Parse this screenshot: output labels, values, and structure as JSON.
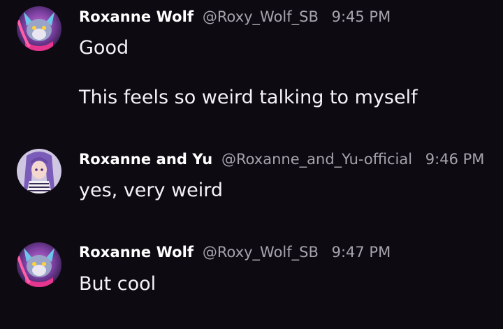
{
  "messages": [
    {
      "author": "Roxanne Wolf",
      "handle": "@Roxy_Wolf_SB",
      "time": "9:45 PM",
      "avatar_icon": "wolf-character-avatar",
      "lines": [
        "Good",
        "This feels so weird talking to myself"
      ]
    },
    {
      "author": "Roxanne and Yu",
      "handle": "@Roxanne_and_Yu-official",
      "time": "9:46 PM",
      "avatar_icon": "purple-haired-character-avatar",
      "lines": [
        "yes, very weird"
      ]
    },
    {
      "author": "Roxanne Wolf",
      "handle": "@Roxy_Wolf_SB",
      "time": "9:47 PM",
      "avatar_icon": "wolf-character-avatar",
      "lines": [
        "But cool"
      ]
    }
  ],
  "colors": {
    "background": "#0e0a12",
    "name": "#ffffff",
    "meta": "#a7a3ad",
    "text": "#f5f3f7"
  }
}
